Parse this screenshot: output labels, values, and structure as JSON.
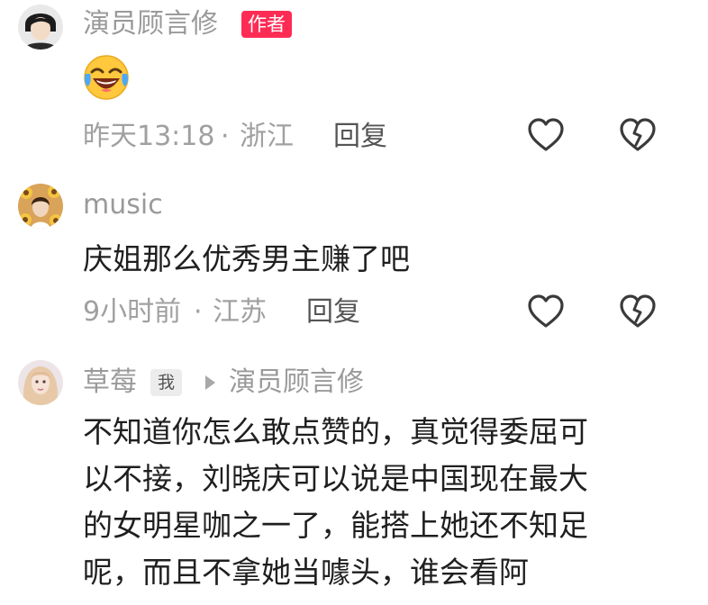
{
  "comments": [
    {
      "author": "演员顾言修",
      "author_badge": "作者",
      "content_emoji": "laughing-crying-emoji",
      "time": "昨天13:18",
      "location": "浙江",
      "separator": "·",
      "reply_label": "回复"
    },
    {
      "author": "music",
      "content": "庆姐那么优秀男主赚了吧",
      "time": "9小时前",
      "location": "江苏",
      "separator": "·",
      "reply_label": "回复"
    },
    {
      "author": "草莓",
      "me_badge": "我",
      "reply_to": "演员顾言修",
      "content_lines": [
        "不知道你怎么敢点赞的，真觉得委屈可",
        "以不接，刘晓庆可以说是中国现在最大",
        "的女明星咖之一了，能搭上她还不知足",
        "呢，而且不拿她当噱头，谁会看阿"
      ]
    }
  ],
  "icons": {
    "like": "heart-outline-icon",
    "dislike": "broken-heart-outline-icon"
  },
  "colors": {
    "author_badge_bg": "#fe2c55",
    "meta_text": "#a0a0a0",
    "content_text": "#1f1f1f"
  }
}
